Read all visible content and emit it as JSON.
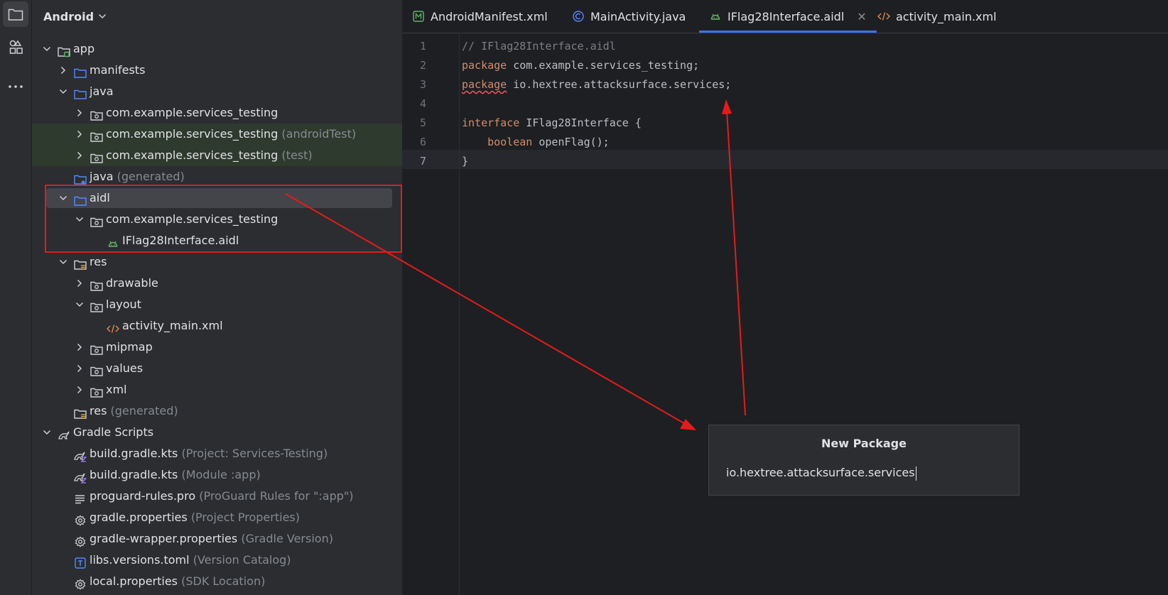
{
  "toolstrip": {
    "items": [
      "project-icon",
      "structure-icon",
      "more-icon"
    ]
  },
  "project": {
    "header": "Android",
    "tree": [
      {
        "name": "app",
        "hint": "",
        "indent": 0,
        "arrow": "down",
        "icon": "module-folder-icon"
      },
      {
        "name": "manifests",
        "hint": "",
        "indent": 1,
        "arrow": "right",
        "icon": "folder-icon"
      },
      {
        "name": "java",
        "hint": "",
        "indent": 1,
        "arrow": "down",
        "icon": "folder-icon"
      },
      {
        "name": "com.example.services_testing",
        "hint": "",
        "indent": 2,
        "arrow": "right",
        "icon": "package-icon"
      },
      {
        "name": "com.example.services_testing",
        "hint": "(androidTest)",
        "indent": 2,
        "arrow": "right",
        "icon": "package-icon",
        "green": true
      },
      {
        "name": "com.example.services_testing",
        "hint": "(test)",
        "indent": 2,
        "arrow": "right",
        "icon": "package-icon",
        "green": true
      },
      {
        "name": "java",
        "hint": "(generated)",
        "indent": 1,
        "arrow": "",
        "icon": "generated-folder-icon"
      },
      {
        "name": "aidl",
        "hint": "",
        "indent": 1,
        "arrow": "down",
        "icon": "folder-icon",
        "selected": true
      },
      {
        "name": "com.example.services_testing",
        "hint": "",
        "indent": 2,
        "arrow": "down",
        "icon": "package-icon"
      },
      {
        "name": "IFlag28Interface.aidl",
        "hint": "",
        "indent": 3,
        "arrow": "",
        "icon": "android-icon"
      },
      {
        "name": "res",
        "hint": "",
        "indent": 1,
        "arrow": "down",
        "icon": "res-folder-icon"
      },
      {
        "name": "drawable",
        "hint": "",
        "indent": 2,
        "arrow": "right",
        "icon": "package-icon"
      },
      {
        "name": "layout",
        "hint": "",
        "indent": 2,
        "arrow": "down",
        "icon": "package-icon"
      },
      {
        "name": "activity_main.xml",
        "hint": "",
        "indent": 3,
        "arrow": "",
        "icon": "xml-icon"
      },
      {
        "name": "mipmap",
        "hint": "",
        "indent": 2,
        "arrow": "right",
        "icon": "package-icon"
      },
      {
        "name": "values",
        "hint": "",
        "indent": 2,
        "arrow": "right",
        "icon": "package-icon"
      },
      {
        "name": "xml",
        "hint": "",
        "indent": 2,
        "arrow": "right",
        "icon": "package-icon"
      },
      {
        "name": "res",
        "hint": "(generated)",
        "indent": 1,
        "arrow": "",
        "icon": "res-folder-icon"
      },
      {
        "name": "Gradle Scripts",
        "hint": "",
        "indent": 0,
        "arrow": "down",
        "icon": "gradle-icon"
      },
      {
        "name": "build.gradle.kts",
        "hint": "(Project: Services-Testing)",
        "indent": 1,
        "arrow": "",
        "icon": "gradle-kts-icon"
      },
      {
        "name": "build.gradle.kts",
        "hint": "(Module :app)",
        "indent": 1,
        "arrow": "",
        "icon": "gradle-kts-icon"
      },
      {
        "name": "proguard-rules.pro",
        "hint": "(ProGuard Rules for \":app\")",
        "indent": 1,
        "arrow": "",
        "icon": "text-file-icon"
      },
      {
        "name": "gradle.properties",
        "hint": "(Project Properties)",
        "indent": 1,
        "arrow": "",
        "icon": "settings-file-icon"
      },
      {
        "name": "gradle-wrapper.properties",
        "hint": "(Gradle Version)",
        "indent": 1,
        "arrow": "",
        "icon": "settings-file-icon"
      },
      {
        "name": "libs.versions.toml",
        "hint": "(Version Catalog)",
        "indent": 1,
        "arrow": "",
        "icon": "toml-icon"
      },
      {
        "name": "local.properties",
        "hint": "(SDK Location)",
        "indent": 1,
        "arrow": "",
        "icon": "settings-file-icon"
      }
    ]
  },
  "tabs": [
    {
      "label": "AndroidManifest.xml",
      "icon": "manifest-icon",
      "active": false
    },
    {
      "label": "MainActivity.java",
      "icon": "class-icon",
      "active": false
    },
    {
      "label": "IFlag28Interface.aidl",
      "icon": "android-icon",
      "active": true
    },
    {
      "label": "activity_main.xml",
      "icon": "xml-icon",
      "active": false
    }
  ],
  "editor": {
    "current_line": 7,
    "lines": [
      {
        "n": "1",
        "parts": [
          {
            "t": "// IFlag28Interface.aidl",
            "c": "cm"
          }
        ]
      },
      {
        "n": "2",
        "parts": [
          {
            "t": "package",
            "c": "kw"
          },
          {
            "t": " com.example.services_testing;",
            "c": ""
          }
        ]
      },
      {
        "n": "3",
        "parts": [
          {
            "t": "package",
            "c": "kw squig"
          },
          {
            "t": " io.hextree.attacksurface.services;",
            "c": ""
          }
        ]
      },
      {
        "n": "4",
        "parts": []
      },
      {
        "n": "5",
        "parts": [
          {
            "t": "interface",
            "c": "kw"
          },
          {
            "t": " IFlag28Interface {",
            "c": ""
          }
        ]
      },
      {
        "n": "6",
        "parts": [
          {
            "t": "    ",
            "c": ""
          },
          {
            "t": "boolean",
            "c": "kw"
          },
          {
            "t": " openFlag();",
            "c": ""
          }
        ]
      },
      {
        "n": "7",
        "parts": [
          {
            "t": "}",
            "c": ""
          }
        ]
      }
    ]
  },
  "dialog": {
    "title": "New Package",
    "value": "io.hextree.attacksurface.services"
  },
  "colors": {
    "annotation": "#e51b1b",
    "accent": "#3574f0",
    "keyword": "#cf8e6d",
    "comment": "#7a7e85"
  }
}
